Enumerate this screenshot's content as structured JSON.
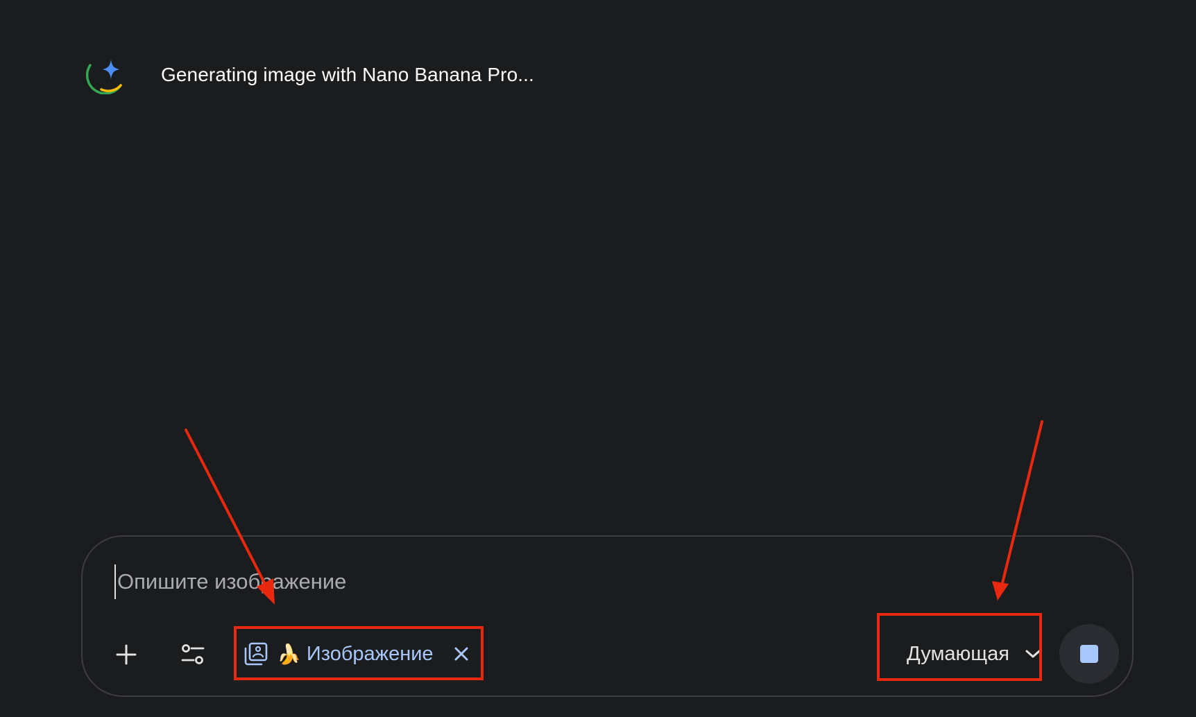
{
  "status": {
    "text": "Generating image with Nano Banana Pro..."
  },
  "composer": {
    "placeholder": "Опишите изображение",
    "tool_chip": {
      "emoji": "🍌",
      "label": "Изображение"
    },
    "model_selector": {
      "selected": "Думающая"
    }
  },
  "colors": {
    "background": "#1b1c1e",
    "chip_accent": "#a8c7fa",
    "annotation_red": "#e8290f",
    "stop_button_bg": "#2a2c31"
  },
  "icons": {
    "status": "gemini-spark-icon",
    "add": "plus-icon",
    "tools": "tools-sliders-icon",
    "chip": "image-gallery-icon",
    "chip_close": "close-icon",
    "model_chevron": "chevron-down-icon",
    "stop": "stop-icon"
  }
}
